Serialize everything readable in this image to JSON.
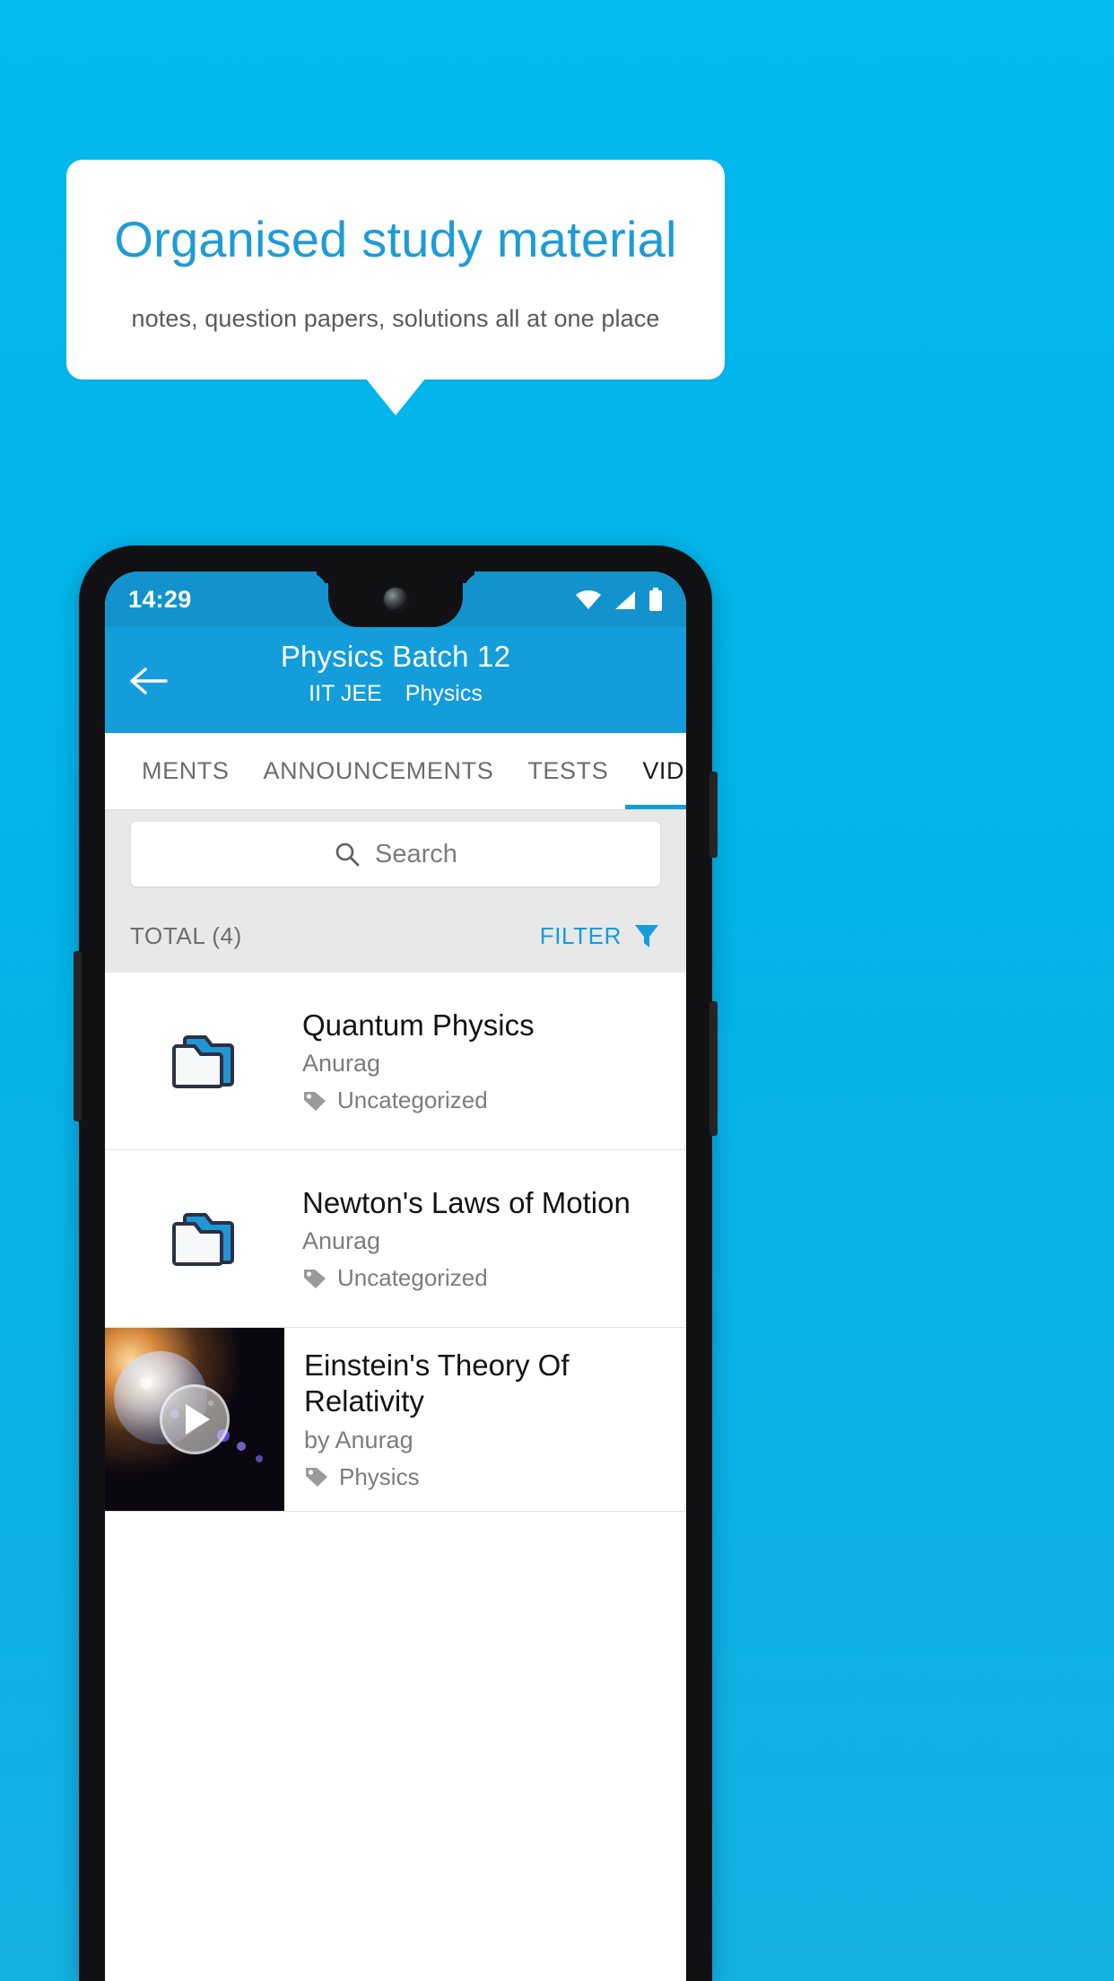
{
  "promo": {
    "title": "Organised study material",
    "subtitle": "notes, question papers, solutions all at one place",
    "accent_color": "#1E9BD7",
    "background_color": "#02B3E9"
  },
  "phone": {
    "status_bar": {
      "clock": "14:29",
      "icons": [
        "wifi-icon",
        "signal-icon",
        "battery-icon"
      ],
      "background_color": "#1293CE"
    },
    "app_bar": {
      "back_icon": "back-arrow-icon",
      "title": "Physics Batch 12",
      "subtitle_exam": "IIT JEE",
      "subtitle_subject": "Physics",
      "background_color": "#139DDB"
    },
    "tabs": [
      {
        "label": "MENTS",
        "active": false
      },
      {
        "label": "ANNOUNCEMENTS",
        "active": false
      },
      {
        "label": "TESTS",
        "active": false
      },
      {
        "label": "VIDEOS",
        "active": true
      }
    ],
    "search": {
      "placeholder": "Search",
      "icon": "search-icon"
    },
    "toolbar": {
      "total_label": "TOTAL (4)",
      "filter_label": "FILTER",
      "filter_icon": "filter-funnel-icon",
      "filter_color": "#139DDB"
    },
    "items": [
      {
        "type": "folder",
        "icon": "folder-icon",
        "title": "Quantum Physics",
        "author": "Anurag",
        "tag_icon": "tag-icon",
        "tag": "Uncategorized"
      },
      {
        "type": "folder",
        "icon": "folder-icon",
        "title": "Newton's Laws of Motion",
        "author": "Anurag",
        "tag_icon": "tag-icon",
        "tag": "Uncategorized"
      },
      {
        "type": "video",
        "icon": "video-thumbnail",
        "play_icon": "play-icon",
        "title": "Einstein's Theory Of Relativity",
        "author": "by Anurag",
        "tag_icon": "tag-icon",
        "tag": "Physics"
      }
    ]
  }
}
